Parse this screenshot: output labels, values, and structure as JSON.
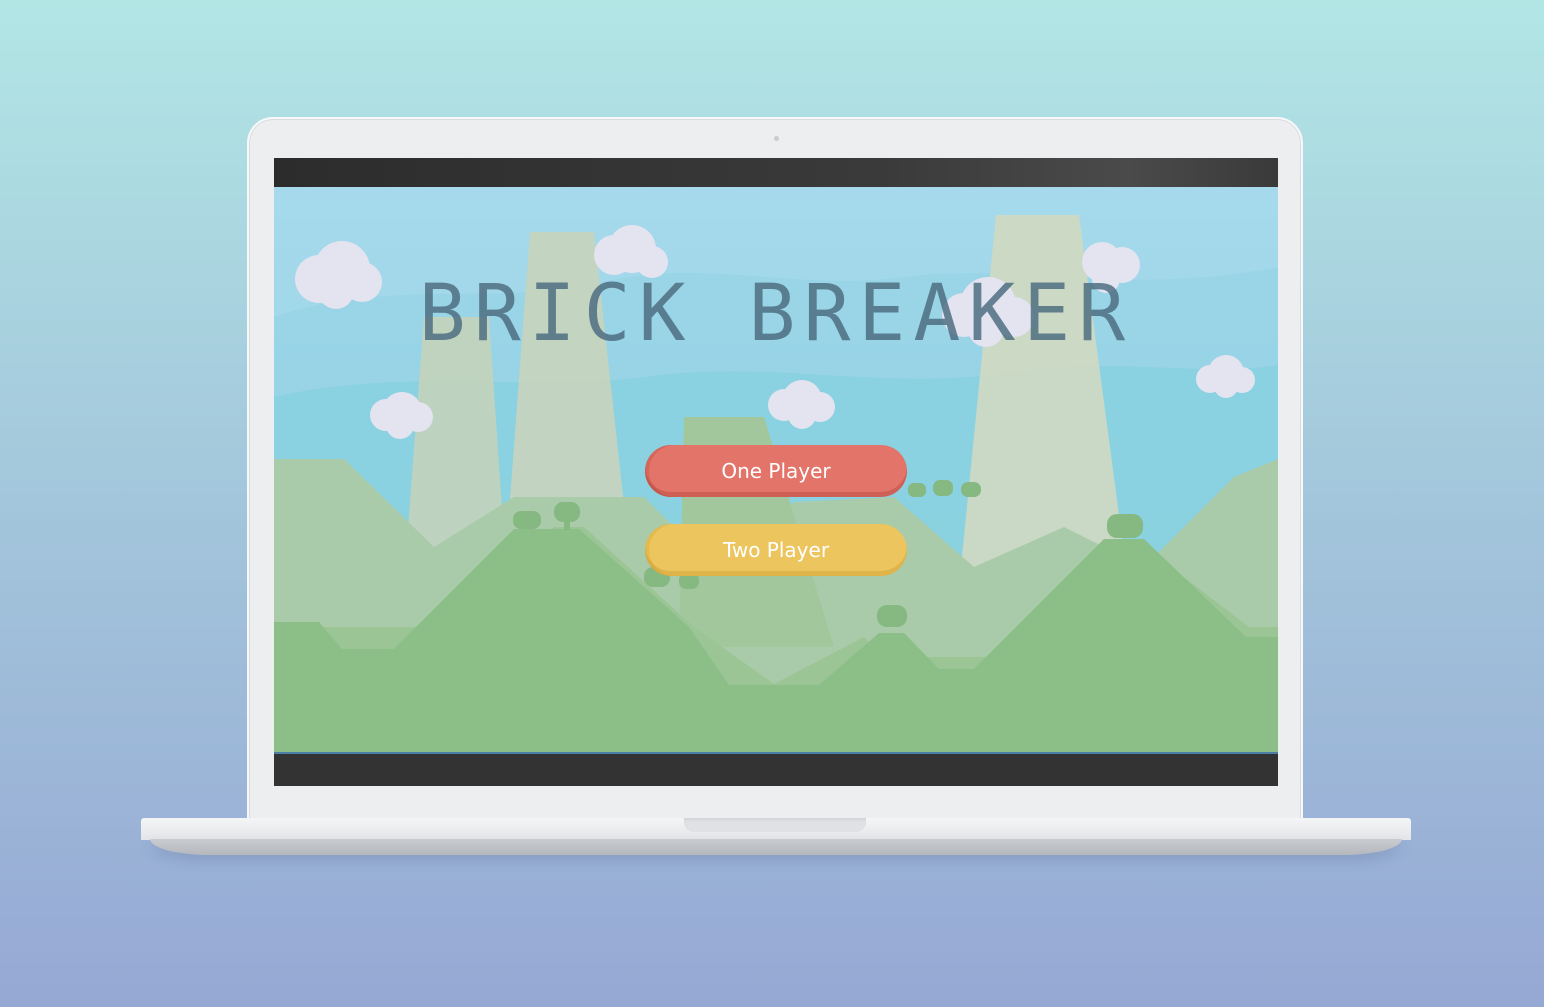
{
  "game": {
    "title": "BRICK BREAKER",
    "menu": {
      "one_player_label": "One Player",
      "two_player_label": "Two Player"
    }
  },
  "colors": {
    "sky": "#9ed8e8",
    "one_player_button": "#e27469",
    "two_player_button": "#ecc55e",
    "title": "#4f6f82",
    "hills": "#8bbf87"
  }
}
